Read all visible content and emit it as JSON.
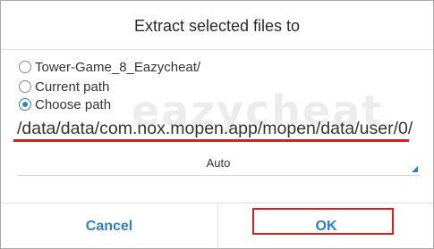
{
  "dialog": {
    "title": "Extract selected files to",
    "options": [
      {
        "label": "Tower-Game_8_Eazycheat/",
        "checked": false
      },
      {
        "label": "Current path",
        "checked": false
      },
      {
        "label": "Choose path",
        "checked": true
      }
    ],
    "path_value": "/data/data/com.nox.mopen.app/mopen/data/user/0/",
    "encoding_select": "Auto",
    "buttons": {
      "cancel": "Cancel",
      "ok": "OK"
    },
    "watermark": "eazycheat"
  },
  "colors": {
    "accent": "#2f7fc4",
    "highlight": "#d42020"
  }
}
